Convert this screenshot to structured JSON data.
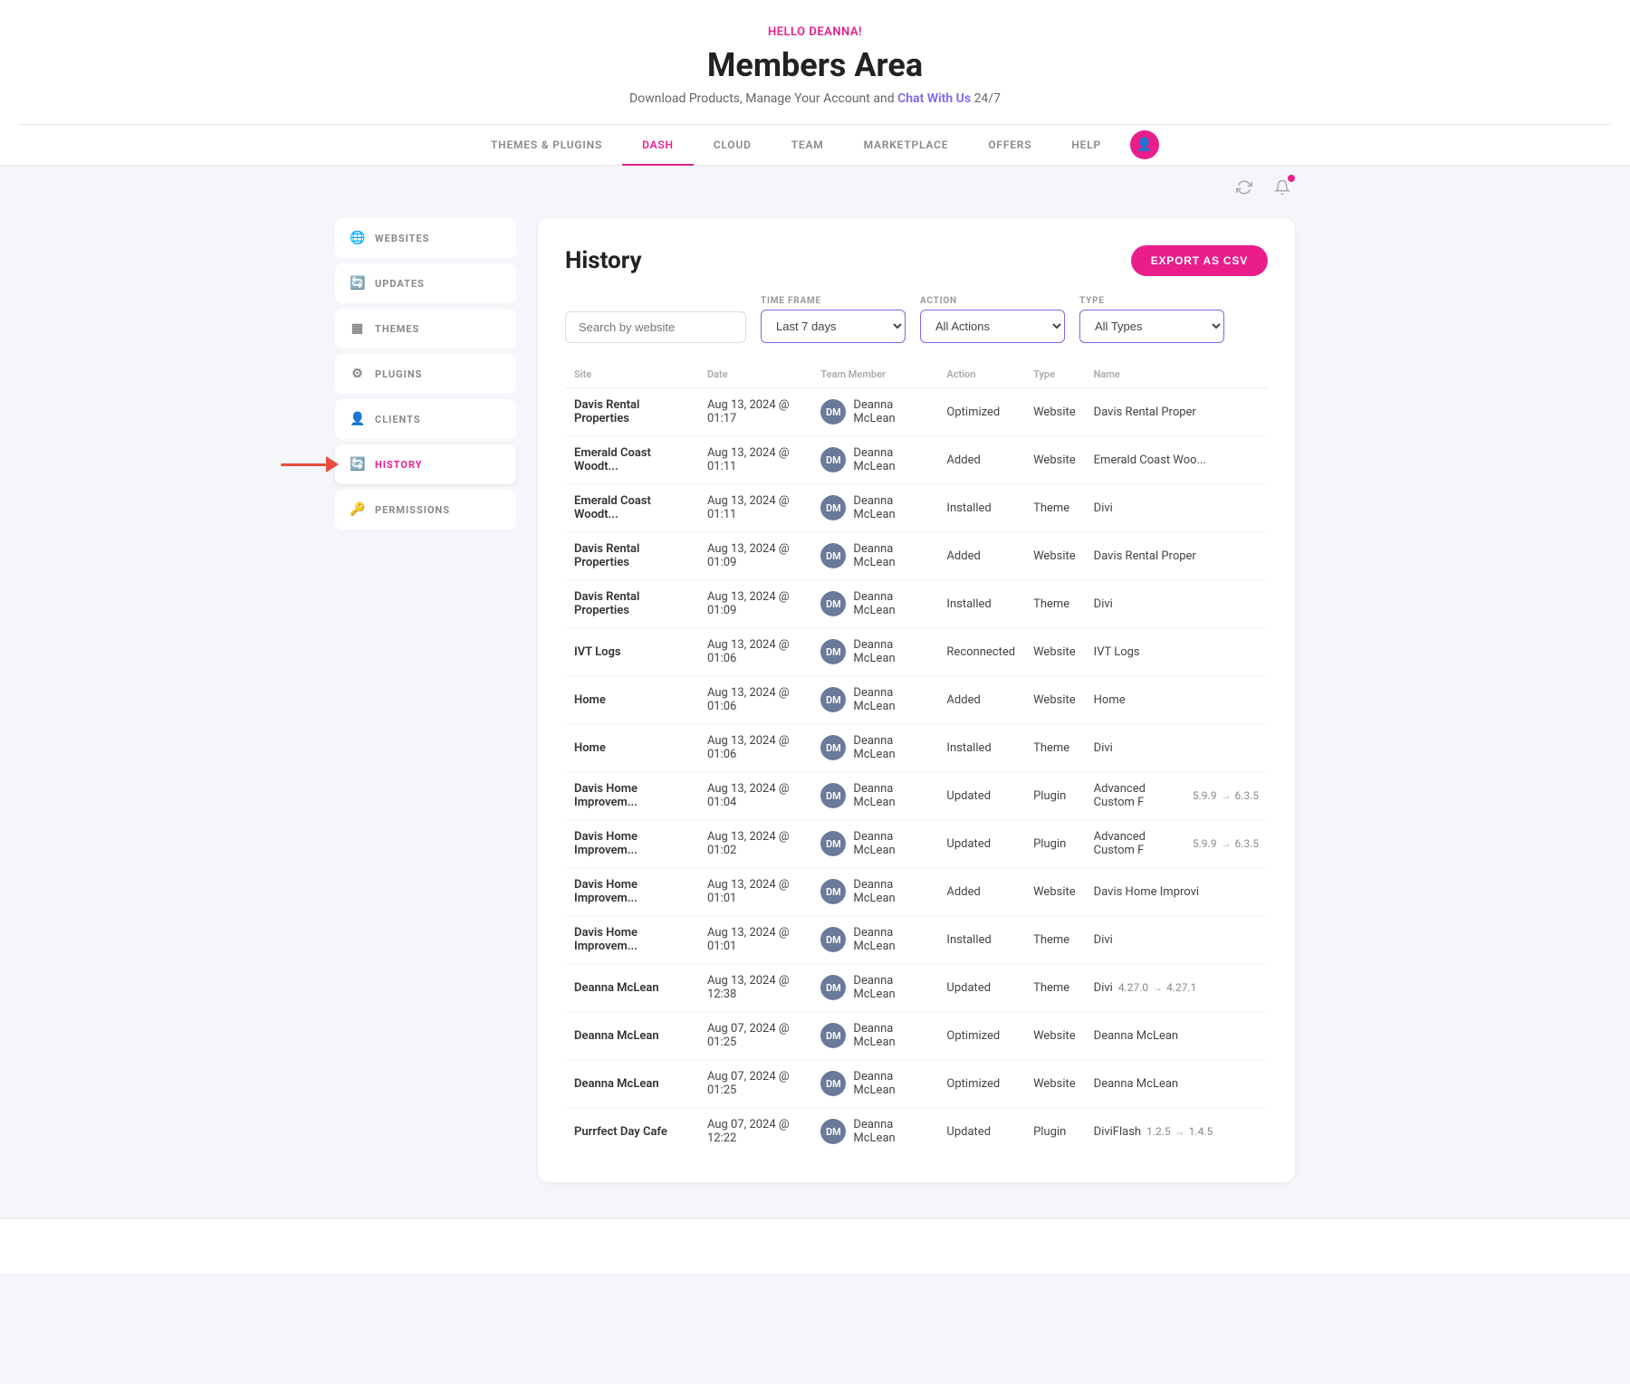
{
  "header": {
    "hello_text": "HELLO DEANNA!",
    "title": "Members Area",
    "subtitle_text": "Download Products, Manage Your Account and",
    "subtitle_link": "Chat With Us",
    "subtitle_suffix": "24/7"
  },
  "nav": {
    "items": [
      {
        "label": "THEMES & PLUGINS",
        "active": false
      },
      {
        "label": "DASH",
        "active": true
      },
      {
        "label": "CLOUD",
        "active": false
      },
      {
        "label": "TEAM",
        "active": false
      },
      {
        "label": "MARKETPLACE",
        "active": false
      },
      {
        "label": "OFFERS",
        "active": false
      },
      {
        "label": "HELP",
        "active": false
      }
    ]
  },
  "sidebar": {
    "items": [
      {
        "label": "WEBSITES",
        "icon": "🌐",
        "active": false
      },
      {
        "label": "UPDATES",
        "icon": "🔄",
        "active": false
      },
      {
        "label": "THEMES",
        "icon": "▦",
        "active": false
      },
      {
        "label": "PLUGINS",
        "icon": "⚙",
        "active": false
      },
      {
        "label": "CLIENTS",
        "icon": "👤",
        "active": false
      },
      {
        "label": "HISTORY",
        "icon": "🔄",
        "active": true
      },
      {
        "label": "PERMISSIONS",
        "icon": "🔑",
        "active": false
      }
    ]
  },
  "history": {
    "title": "History",
    "export_btn": "EXPORT AS CSV",
    "filters": {
      "search_placeholder": "Search by website",
      "time_frame_label": "TIME FRAME",
      "time_frame_value": "Last 7 days",
      "action_label": "ACTION",
      "action_value": "All Actions",
      "type_label": "TYPE",
      "type_value": "All Types"
    },
    "columns": [
      "Site",
      "Date",
      "Team Member",
      "Action",
      "Type",
      "Name"
    ],
    "rows": [
      {
        "site": "Davis Rental Properties",
        "date": "Aug 13, 2024 @ 01:17",
        "team_member": "Deanna McLean",
        "action": "Optimized",
        "type": "Website",
        "name": "Davis Rental Proper",
        "version_from": "",
        "version_to": ""
      },
      {
        "site": "Emerald Coast Woodt...",
        "date": "Aug 13, 2024 @ 01:11",
        "team_member": "Deanna McLean",
        "action": "Added",
        "type": "Website",
        "name": "Emerald Coast Woo...",
        "version_from": "",
        "version_to": ""
      },
      {
        "site": "Emerald Coast Woodt...",
        "date": "Aug 13, 2024 @ 01:11",
        "team_member": "Deanna McLean",
        "action": "Installed",
        "type": "Theme",
        "name": "Divi",
        "version_from": "",
        "version_to": ""
      },
      {
        "site": "Davis Rental Properties",
        "date": "Aug 13, 2024 @ 01:09",
        "team_member": "Deanna McLean",
        "action": "Added",
        "type": "Website",
        "name": "Davis Rental Proper",
        "version_from": "",
        "version_to": ""
      },
      {
        "site": "Davis Rental Properties",
        "date": "Aug 13, 2024 @ 01:09",
        "team_member": "Deanna McLean",
        "action": "Installed",
        "type": "Theme",
        "name": "Divi",
        "version_from": "",
        "version_to": ""
      },
      {
        "site": "IVT Logs",
        "date": "Aug 13, 2024 @ 01:06",
        "team_member": "Deanna McLean",
        "action": "Reconnected",
        "type": "Website",
        "name": "IVT Logs",
        "version_from": "",
        "version_to": ""
      },
      {
        "site": "Home",
        "date": "Aug 13, 2024 @ 01:06",
        "team_member": "Deanna McLean",
        "action": "Added",
        "type": "Website",
        "name": "Home",
        "version_from": "",
        "version_to": ""
      },
      {
        "site": "Home",
        "date": "Aug 13, 2024 @ 01:06",
        "team_member": "Deanna McLean",
        "action": "Installed",
        "type": "Theme",
        "name": "Divi",
        "version_from": "",
        "version_to": ""
      },
      {
        "site": "Davis Home Improvem...",
        "date": "Aug 13, 2024 @ 01:04",
        "team_member": "Deanna McLean",
        "action": "Updated",
        "type": "Plugin",
        "name": "Advanced Custom F",
        "version_from": "5.9.9",
        "version_to": "6.3.5"
      },
      {
        "site": "Davis Home Improvem...",
        "date": "Aug 13, 2024 @ 01:02",
        "team_member": "Deanna McLean",
        "action": "Updated",
        "type": "Plugin",
        "name": "Advanced Custom F",
        "version_from": "5.9.9",
        "version_to": "6.3.5"
      },
      {
        "site": "Davis Home Improvem...",
        "date": "Aug 13, 2024 @ 01:01",
        "team_member": "Deanna McLean",
        "action": "Added",
        "type": "Website",
        "name": "Davis Home Improvi",
        "version_from": "",
        "version_to": ""
      },
      {
        "site": "Davis Home Improvem...",
        "date": "Aug 13, 2024 @ 01:01",
        "team_member": "Deanna McLean",
        "action": "Installed",
        "type": "Theme",
        "name": "Divi",
        "version_from": "",
        "version_to": ""
      },
      {
        "site": "Deanna McLean",
        "date": "Aug 13, 2024 @ 12:38",
        "team_member": "Deanna McLean",
        "action": "Updated",
        "type": "Theme",
        "name": "Divi",
        "version_from": "4.27.0",
        "version_to": "4.27.1"
      },
      {
        "site": "Deanna McLean",
        "date": "Aug 07, 2024 @ 01:25",
        "team_member": "Deanna McLean",
        "action": "Optimized",
        "type": "Website",
        "name": "Deanna McLean",
        "version_from": "",
        "version_to": ""
      },
      {
        "site": "Deanna McLean",
        "date": "Aug 07, 2024 @ 01:25",
        "team_member": "Deanna McLean",
        "action": "Optimized",
        "type": "Website",
        "name": "Deanna McLean",
        "version_from": "",
        "version_to": ""
      },
      {
        "site": "Purrfect Day Cafe",
        "date": "Aug 07, 2024 @ 12:22",
        "team_member": "Deanna McLean",
        "action": "Updated",
        "type": "Plugin",
        "name": "DiviFlash",
        "version_from": "1.2.5",
        "version_to": "1.4.5"
      }
    ]
  }
}
